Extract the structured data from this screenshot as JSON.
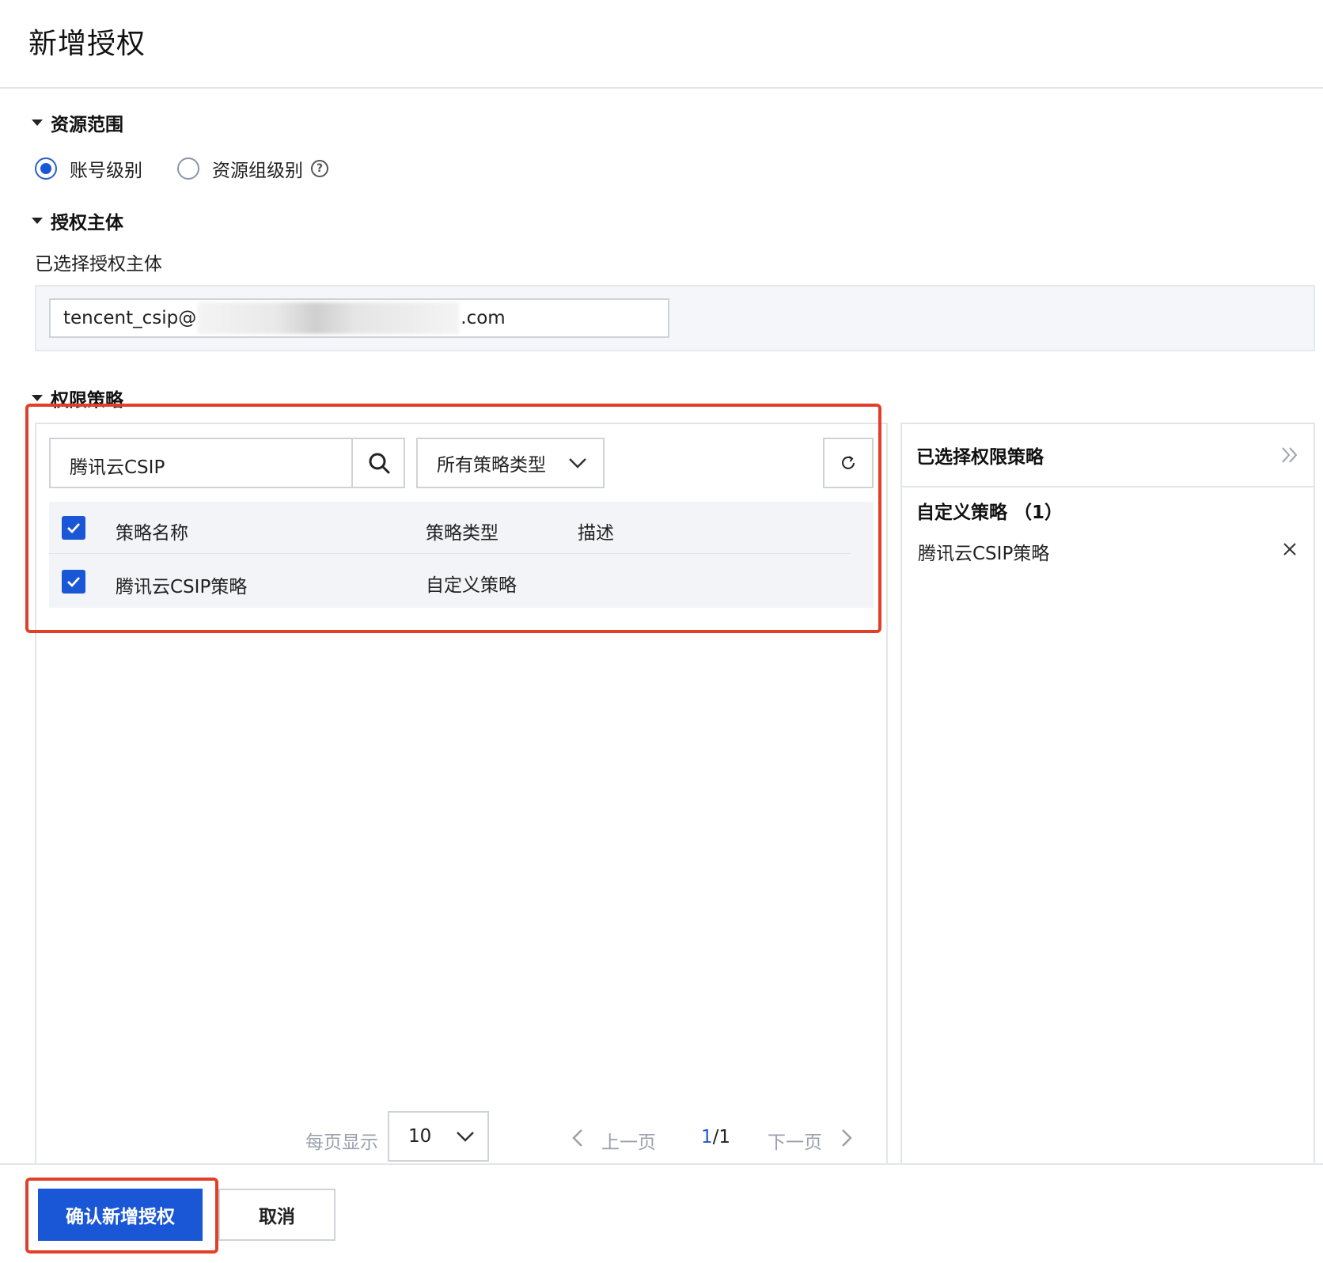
{
  "page": {
    "title": "新增授权"
  },
  "resource_scope": {
    "heading": "资源范围",
    "options": [
      {
        "label": "账号级别",
        "selected": true
      },
      {
        "label": "资源组级别",
        "selected": false
      }
    ],
    "help_glyph": "?"
  },
  "subject": {
    "heading": "授权主体",
    "selected_label": "已选择授权主体",
    "value_prefix": "tencent_csip@",
    "value_suffix": ".com"
  },
  "policy": {
    "heading": "权限策略",
    "search_value": "腾讯云CSIP",
    "type_filter": "所有策略类型",
    "columns": {
      "name": "策略名称",
      "type": "策略类型",
      "desc": "描述"
    },
    "rows": [
      {
        "name": "腾讯云CSIP策略",
        "type": "自定义策略",
        "desc": "",
        "checked": true
      }
    ],
    "pagination": {
      "per_page_label": "每页显示",
      "per_page_value": "10",
      "prev": "上一页",
      "current": "1",
      "total": "/1",
      "next": "下一页"
    }
  },
  "selected_panel": {
    "title": "已选择权限策略",
    "group_label": "自定义策略 （1）",
    "items": [
      {
        "name": "腾讯云CSIP策略"
      }
    ]
  },
  "actions": {
    "confirm": "确认新增授权",
    "cancel": "取消"
  },
  "colors": {
    "primary": "#1a57d6",
    "highlight": "#e0402a"
  }
}
